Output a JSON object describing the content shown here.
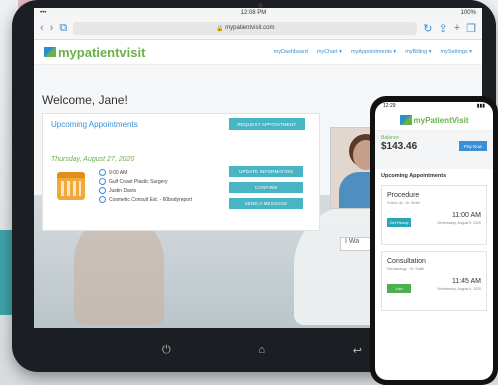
{
  "browser": {
    "time": "12:08 PM",
    "battery": "100%",
    "url": "mypatientvisit.com"
  },
  "site": {
    "logo": "mypatientvisit",
    "nav": [
      "myDashboard",
      "myChart ▾",
      "myAppointments ▾",
      "myBilling ▾",
      "mySettings ▾"
    ]
  },
  "dashboard": {
    "welcome": "Welcome, Jane!",
    "upcoming_title": "Upcoming Appointments",
    "request_button": "REQUEST APPOINTMENT",
    "date": "Thursday, August 27, 2020",
    "details": [
      "9:00 AM",
      "Gulf Coast Plastic Surgery",
      "Justin Davis",
      "Cosmetic Consult Est. - 60bodyreport"
    ],
    "update_button": "UPDATE INFORMATION",
    "confirm_button": "CONFIRM",
    "message_button": "SEND A MESSAGE",
    "search_value": "I Wa"
  },
  "phone": {
    "time": "12:29",
    "logo": "myPatientVisit",
    "balance_label": "Balance",
    "balance": "$143.46",
    "pay_now": "Pay Now",
    "section": "Upcoming Appointments",
    "appointments": [
      {
        "title": "Procedure",
        "sub": "Follow Up · Dr. Smith",
        "button": "Get Ready",
        "time": "11:00 AM",
        "date": "Wednesday, August 5, 2020",
        "btn_color": "#2aa6b9"
      },
      {
        "title": "Consultation",
        "sub": "Dermatology · Dr. Smith",
        "button": "Join",
        "time": "11:45 AM",
        "date": "Wednesday, August 5, 2020",
        "btn_color": "#4caf50"
      }
    ]
  }
}
